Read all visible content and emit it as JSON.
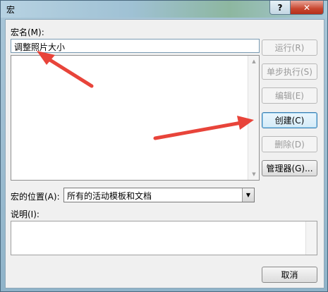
{
  "window": {
    "title": "宏",
    "help_label": "?",
    "close_label": "✕"
  },
  "macro_name": {
    "label": "宏名(M):",
    "value": "调整照片大小"
  },
  "buttons": {
    "run": "运行(R)",
    "step": "单步执行(S)",
    "edit": "编辑(E)",
    "create": "创建(C)",
    "delete": "删除(D)",
    "organizer": "管理器(G)...",
    "cancel": "取消"
  },
  "location": {
    "label": "宏的位置(A):",
    "value": "所有的活动模板和文档"
  },
  "description": {
    "label": "说明(I):",
    "value": ""
  },
  "annotation": {
    "color": "#e8443a"
  }
}
